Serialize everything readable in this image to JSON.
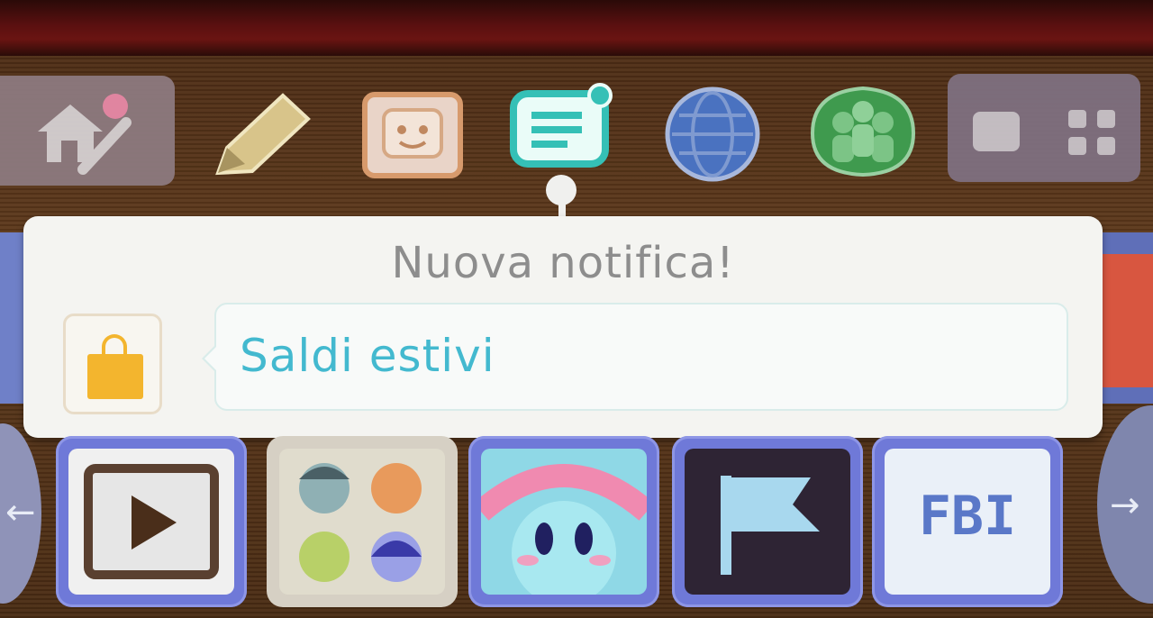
{
  "notification": {
    "title": "Nuova notifica!",
    "message": "Saldi estivi"
  },
  "toolbar": {
    "icons": [
      {
        "name": "home-settings-icon",
        "color": "#8d7a7f"
      },
      {
        "name": "pencil-icon",
        "color": "#d8c48a"
      },
      {
        "name": "camera-face-icon",
        "color": "#d79a6c"
      },
      {
        "name": "notifications-icon",
        "color": "#35c0b6"
      },
      {
        "name": "internet-browser-icon",
        "color": "#4a72c0"
      },
      {
        "name": "friend-list-icon",
        "color": "#3f9a4e"
      },
      {
        "name": "view-toggle-icon",
        "color": "#7f7080"
      }
    ]
  },
  "app_tiles": [
    {
      "name": "play-video-app"
    },
    {
      "name": "mii-plaza-app"
    },
    {
      "name": "kirby-game-app"
    },
    {
      "name": "flag-app"
    },
    {
      "name": "fbi-app",
      "label": "FBI"
    }
  ],
  "colors": {
    "popup_bg": "#f4f4f1",
    "title_text": "#8d8d8d",
    "message_text": "#43b9cf",
    "shop_bag": "#f3b52e",
    "tile_frame": "#6f79d8"
  }
}
